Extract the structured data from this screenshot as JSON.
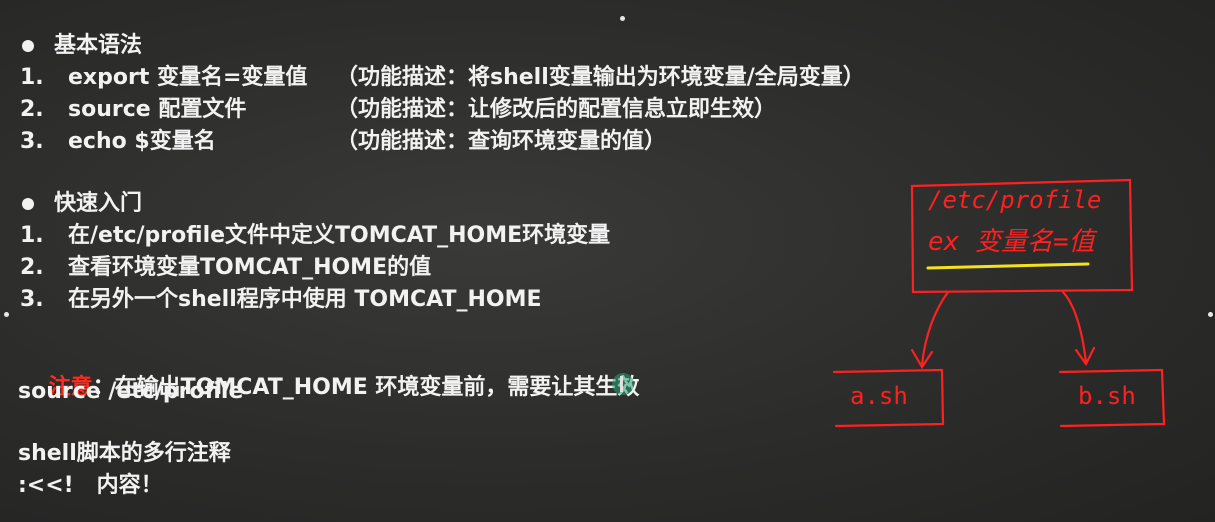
{
  "syntax": {
    "heading": "基本语法",
    "items": [
      {
        "num": "1.",
        "cmd": "export 变量名=变量值",
        "desc": "（功能描述：将shell变量输出为环境变量/全局变量）"
      },
      {
        "num": "2.",
        "cmd": "source 配置文件",
        "desc": "（功能描述：让修改后的配置信息立即生效）"
      },
      {
        "num": "3.",
        "cmd": "echo $变量名",
        "desc": "（功能描述：查询环境变量的值）"
      }
    ]
  },
  "quickstart": {
    "heading": "快速入门",
    "items": [
      {
        "num": "1.",
        "text": "在/etc/profile文件中定义TOMCAT_HOME环境变量"
      },
      {
        "num": "2.",
        "text": "查看环境变量TOMCAT_HOME的值"
      },
      {
        "num": "3.",
        "text": "在另外一个shell程序中使用 TOMCAT_HOME"
      }
    ]
  },
  "note": {
    "label": "注意",
    "text": "：在输出TOMCAT_HOME 环境变量前，需要让其生效",
    "command": "source /etc/profile"
  },
  "comment": {
    "title": "shell脚本的多行注释",
    "syntax": ":<<!   内容！"
  },
  "drawing": {
    "top_box_line1": "/etc/profile",
    "top_box_line2": "ex 变量名=值",
    "left_box": "a.sh",
    "right_box": "b.sh",
    "ink_color": "#ff2020",
    "highlight_color": "#f4e21a"
  }
}
